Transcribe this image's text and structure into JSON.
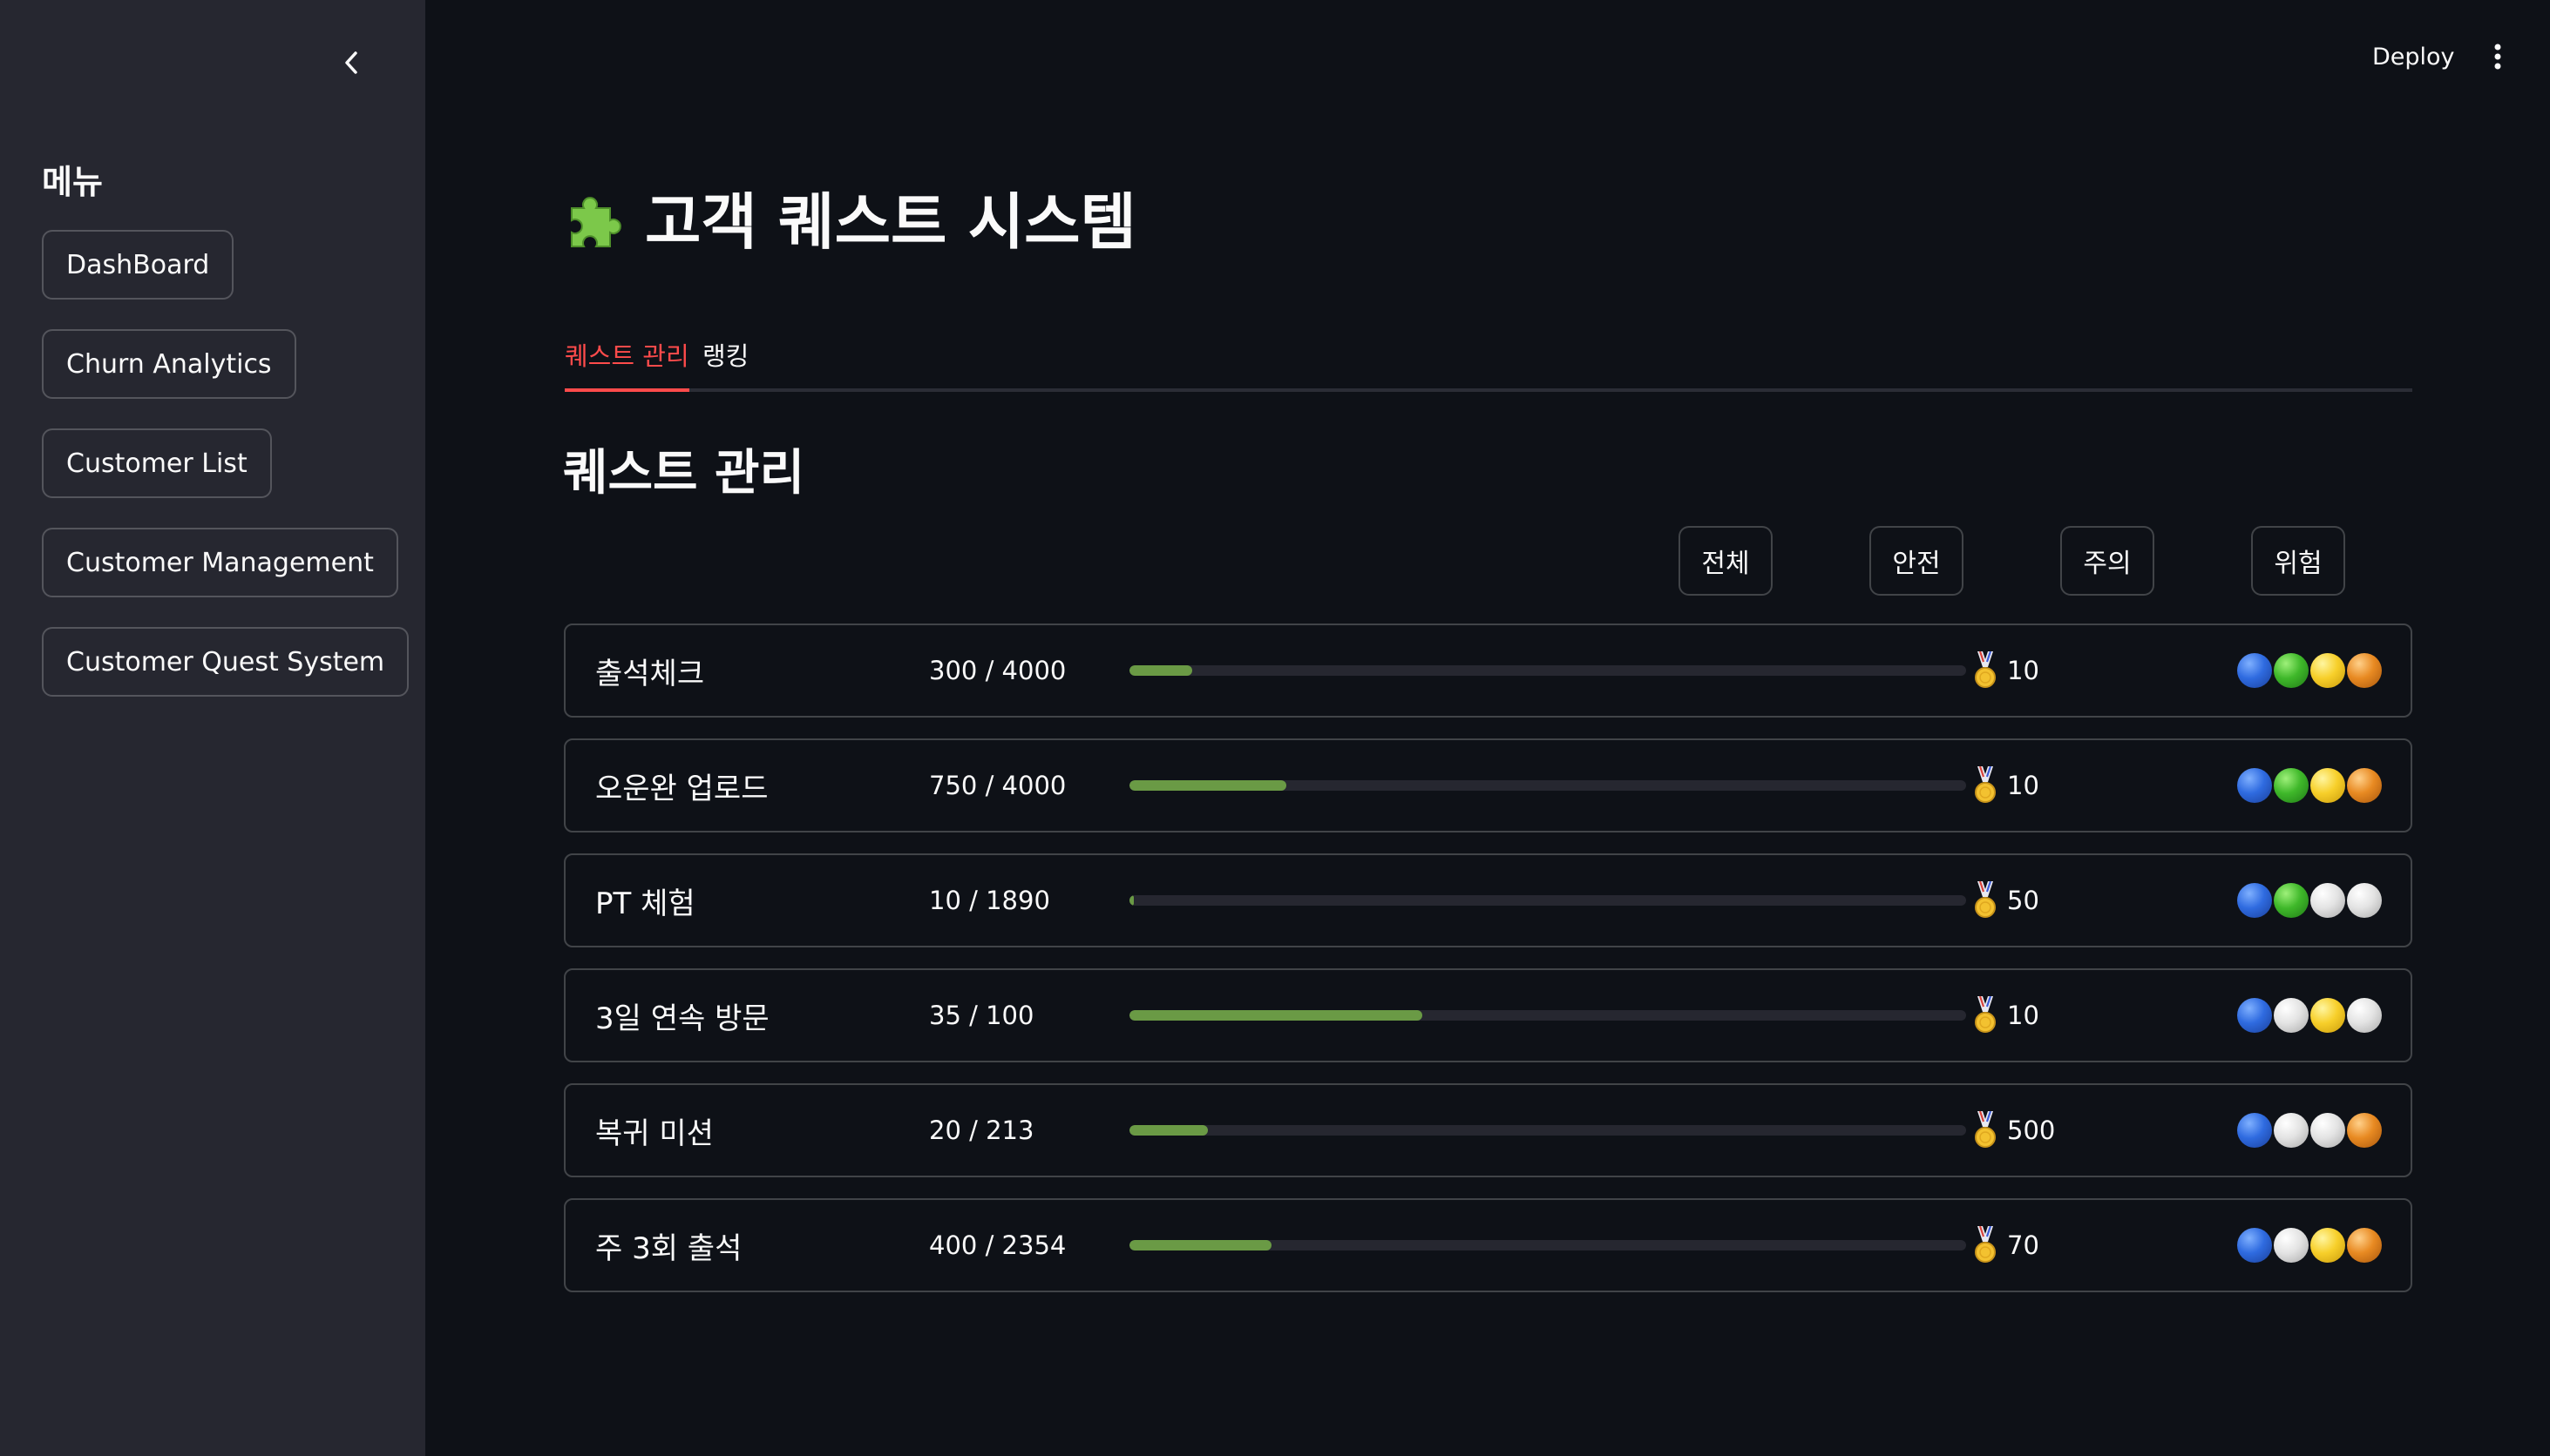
{
  "sidebar": {
    "collapse_icon": "chevron-left-icon",
    "title": "메뉴",
    "items": [
      {
        "label": "DashBoard"
      },
      {
        "label": "Churn Analytics"
      },
      {
        "label": "Customer List"
      },
      {
        "label": "Customer Management"
      },
      {
        "label": "Customer Quest System"
      }
    ]
  },
  "header": {
    "deploy_label": "Deploy",
    "menu_icon": "kebab-menu-icon"
  },
  "main": {
    "title_icon": "puzzle-piece-icon",
    "title": "고객 퀘스트 시스템",
    "tabs": [
      {
        "label": "퀘스트 관리",
        "active": true
      },
      {
        "label": "랭킹",
        "active": false
      }
    ],
    "section_title": "퀘스트 관리",
    "filters": [
      {
        "label": "전체"
      },
      {
        "label": "안전"
      },
      {
        "label": "주의"
      },
      {
        "label": "위험"
      }
    ],
    "quests": [
      {
        "name": "출석체크",
        "progress_text": "300 / 4000",
        "progress": 0.075,
        "reward": "10",
        "orbs": [
          "blue",
          "green",
          "yellow",
          "orange"
        ]
      },
      {
        "name": "오운완 업로드",
        "progress_text": "750 / 4000",
        "progress": 0.1875,
        "reward": "10",
        "orbs": [
          "blue",
          "green",
          "yellow",
          "orange"
        ]
      },
      {
        "name": "PT 체험",
        "progress_text": "10 / 1890",
        "progress": 0.0053,
        "reward": "50",
        "orbs": [
          "blue",
          "green",
          "white",
          "white"
        ]
      },
      {
        "name": "3일 연속 방문",
        "progress_text": "35 / 100",
        "progress": 0.35,
        "reward": "10",
        "orbs": [
          "blue",
          "white",
          "yellow",
          "white"
        ]
      },
      {
        "name": "복귀 미션",
        "progress_text": "20 / 213",
        "progress": 0.0939,
        "reward": "500",
        "orbs": [
          "blue",
          "white",
          "white",
          "orange"
        ]
      },
      {
        "name": "주 3회 출석",
        "progress_text": "400 / 2354",
        "progress": 0.1699,
        "reward": "70",
        "orbs": [
          "blue",
          "white",
          "yellow",
          "orange"
        ]
      }
    ],
    "reward_icon": "medal-icon"
  }
}
